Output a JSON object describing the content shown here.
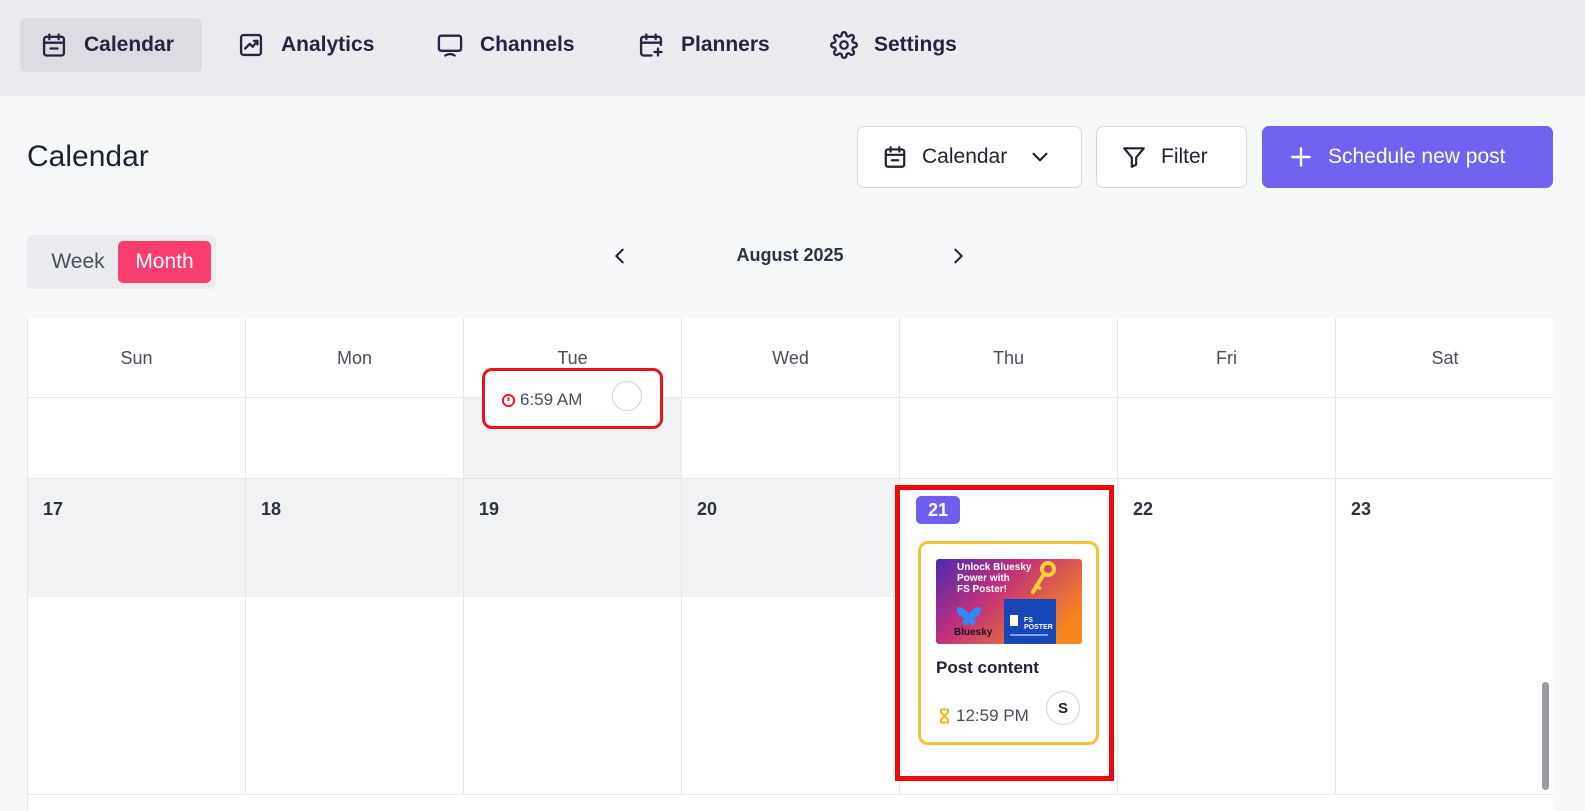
{
  "nav": {
    "items": [
      {
        "label": "Calendar",
        "icon": "calendar-icon",
        "active": true
      },
      {
        "label": "Analytics",
        "icon": "chart-icon",
        "active": false
      },
      {
        "label": "Channels",
        "icon": "monitor-icon",
        "active": false
      },
      {
        "label": "Planners",
        "icon": "calendar-plus-icon",
        "active": false
      },
      {
        "label": "Settings",
        "icon": "gear-icon",
        "active": false
      }
    ]
  },
  "header": {
    "title": "Calendar",
    "view_select_label": "Calendar",
    "filter_label": "Filter",
    "schedule_label": "Schedule new post"
  },
  "toolbar": {
    "week_label": "Week",
    "month_label": "Month",
    "active_view": "Month",
    "period_label": "August 2025"
  },
  "calendar": {
    "weekdays": [
      "Sun",
      "Mon",
      "Tue",
      "Wed",
      "Thu",
      "Fri",
      "Sat"
    ],
    "days": [
      "17",
      "18",
      "19",
      "20",
      "21",
      "22",
      "23"
    ],
    "today": "21",
    "partial_post": {
      "time": "6:59 AM",
      "status": "error"
    },
    "post": {
      "title": "Post content",
      "time": "12:59 PM",
      "avatar_initial": "S",
      "status": "scheduled"
    }
  },
  "thumbnail": {
    "headline_line1": "Unlock Bluesky",
    "headline_line2": "Power with",
    "headline_line3": "FS Poster!",
    "brand_left": "Bluesky",
    "brand_right_line1": "FS",
    "brand_right_line2": "POSTER"
  },
  "colors": {
    "accent": "#7262f0",
    "month_toggle": "#fa3d6f",
    "highlight": "#ee0a0a",
    "scheduled_border": "#f6c23e",
    "error": "#e8141a"
  }
}
